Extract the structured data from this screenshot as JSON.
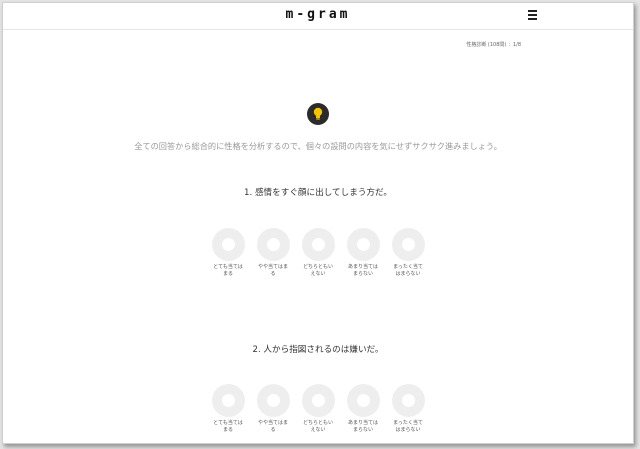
{
  "header": {
    "logo": "m-gram"
  },
  "progress": {
    "label": "性格診断 (108問) ：1/8"
  },
  "intro": {
    "text": "全ての回答から総合的に性格を分析するので、個々の設問の内容を気にせずサクサク進みましょう。"
  },
  "questions": [
    {
      "text": "1. 感情をすぐ顔に出してしまう方だ。",
      "options": [
        {
          "label": "とても当ては\nまる"
        },
        {
          "label": "やや当てはま\nる"
        },
        {
          "label": "どちらともい\nえない"
        },
        {
          "label": "あまり当ては\nまらない"
        },
        {
          "label": "まったく当て\nはまらない"
        }
      ]
    },
    {
      "text": "2. 人から指図されるのは嫌いだ。",
      "options": [
        {
          "label": "とても当ては\nまる"
        },
        {
          "label": "やや当てはま\nる"
        },
        {
          "label": "どちらともい\nえない"
        },
        {
          "label": "あまり当ては\nまらない"
        },
        {
          "label": "まったく当て\nはまらない"
        }
      ]
    }
  ],
  "icons": {
    "menu": "hamburger-menu-icon",
    "hint": "lightbulb-icon"
  },
  "colors": {
    "bulb_bg": "#2b2b2b",
    "bulb": "#f5c400",
    "ring": "#eeeeee"
  }
}
